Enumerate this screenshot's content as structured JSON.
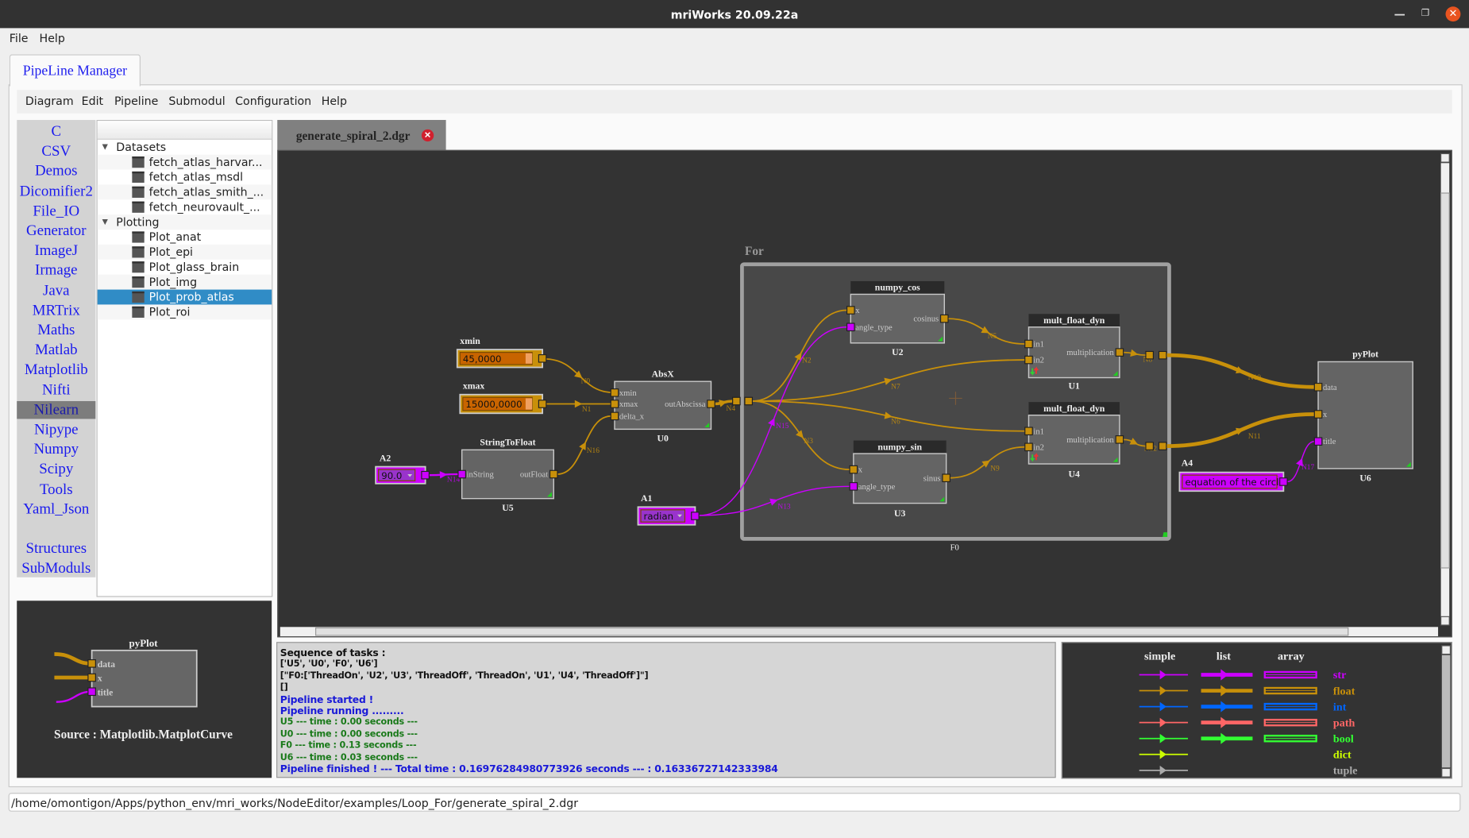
{
  "window": {
    "title": "mriWorks 20.09.22a",
    "minimize_icon": "minimize-icon",
    "restore_icon": "restore-icon",
    "close_icon": "close-icon"
  },
  "menubar": {
    "items": [
      "File",
      "Help"
    ]
  },
  "main_tab": "PipeLine Manager",
  "inner_menu": {
    "items": [
      "Diagram",
      "Edit",
      "Pipeline",
      "Submodul",
      "Configuration",
      "Help"
    ]
  },
  "library": {
    "items": [
      "C",
      "CSV",
      "Demos",
      "Dicomifier2",
      "File_IO",
      "Generator",
      "ImageJ",
      "Irmage",
      "Java",
      "MRTrix",
      "Maths",
      "Matlab",
      "Matplotlib",
      "Nifti",
      "Nilearn",
      "Nipype",
      "Numpy",
      "Scipy",
      "Tools",
      "Yaml_Json"
    ],
    "extra": [
      "Structures",
      "SubModuls"
    ],
    "selected": "Nilearn"
  },
  "tree": {
    "groups": [
      {
        "label": "Datasets",
        "items": [
          "fetch_atlas_harvar...",
          "fetch_atlas_msdl",
          "fetch_atlas_smith_...",
          "fetch_neurovault_..."
        ]
      },
      {
        "label": "Plotting",
        "items": [
          "Plot_anat",
          "Plot_epi",
          "Plot_glass_brain",
          "Plot_img",
          "Plot_prob_atlas",
          "Plot_roi"
        ]
      }
    ],
    "selected": "Plot_prob_atlas"
  },
  "preview": {
    "node_title": "pyPlot",
    "ports": [
      "data",
      "x",
      "title"
    ],
    "source": "Source : Matplotlib.MatplotCurve"
  },
  "diagram_tab": {
    "label": "generate_spiral_2.dgr"
  },
  "colors": {
    "float": "#c8900a",
    "str": "#cc00ff",
    "int": "#0066ff",
    "path": "#ff6666",
    "bool": "#33ff33",
    "dict": "#ccff00",
    "tuple": "#aaaaaa"
  },
  "diagram": {
    "for_label": "For",
    "frame_id": "F0",
    "constants": {
      "xmin": {
        "label": "xmin",
        "value": "45,0000"
      },
      "xmax": {
        "label": "xmax",
        "value": "15000,0000"
      },
      "A2": {
        "label": "A2",
        "value": "90.0"
      },
      "A1": {
        "label": "A1",
        "value": "radian"
      },
      "A4": {
        "label": "A4",
        "value": "equation of the circle"
      }
    },
    "nodes": {
      "U0": {
        "title": "AbsX",
        "id": "U0",
        "inputs": [
          "xmin",
          "xmax",
          "delta_x"
        ],
        "outputs": [
          "outAbscissa"
        ]
      },
      "U5": {
        "title": "StringToFloat",
        "id": "U5",
        "inputs": [
          "inString"
        ],
        "outputs": [
          "outFloat"
        ]
      },
      "U2": {
        "title": "numpy_cos",
        "id": "U2",
        "inputs": [
          "x",
          "angle_type"
        ],
        "outputs": [
          "cosinus"
        ]
      },
      "U3": {
        "title": "numpy_sin",
        "id": "U3",
        "inputs": [
          "x",
          "angle_type"
        ],
        "outputs": [
          "sinus"
        ]
      },
      "U1": {
        "title": "mult_float_dyn",
        "id": "U1",
        "inputs": [
          "in1",
          "in2"
        ],
        "outputs": [
          "multiplication"
        ]
      },
      "U4": {
        "title": "mult_float_dyn",
        "id": "U4",
        "inputs": [
          "in1",
          "in2"
        ],
        "outputs": [
          "multiplication"
        ]
      },
      "U6": {
        "title": "pyPlot",
        "id": "U6",
        "inputs": [
          "data",
          "x",
          "title"
        ],
        "outputs": []
      }
    },
    "edges": [
      {
        "label": "N0",
        "type": "float"
      },
      {
        "label": "N1",
        "type": "float"
      },
      {
        "label": "N16",
        "type": "float"
      },
      {
        "label": "N14",
        "type": "str"
      },
      {
        "label": "N4",
        "type": "float"
      },
      {
        "label": "N2",
        "type": "float"
      },
      {
        "label": "N3",
        "type": "float"
      },
      {
        "label": "N7",
        "type": "float"
      },
      {
        "label": "N6",
        "type": "float"
      },
      {
        "label": "N15",
        "type": "str"
      },
      {
        "label": "N13",
        "type": "str"
      },
      {
        "label": "N5",
        "type": "float"
      },
      {
        "label": "N9",
        "type": "float"
      },
      {
        "label": "N8",
        "type": "float"
      },
      {
        "label": "N12",
        "type": "float"
      },
      {
        "label": "N10",
        "type": "float"
      },
      {
        "label": "N11",
        "type": "float"
      },
      {
        "label": "N17",
        "type": "str"
      }
    ]
  },
  "console": {
    "lines": [
      {
        "text": "Sequence of tasks :",
        "color": "#111111"
      },
      {
        "text": "['U5', 'U0', 'F0', 'U6']",
        "color": "#111111"
      },
      {
        "text": "[\"F0:['ThreadOn', 'U2', 'U3', 'ThreadOff', 'ThreadOn', 'U1', 'U4', 'ThreadOff']\"]",
        "color": "#111111"
      },
      {
        "text": "[]",
        "color": "#111111"
      },
      {
        "text": "Pipeline started !",
        "color": "#1a1ad8"
      },
      {
        "text": "Pipeline running .........",
        "color": "#1a1ad8"
      },
      {
        "text": "U5 --- time : 0.00 seconds ---",
        "color": "#1a7a1a"
      },
      {
        "text": "U0 --- time : 0.00 seconds ---",
        "color": "#1a7a1a"
      },
      {
        "text": "F0 --- time : 0.13 seconds ---",
        "color": "#1a7a1a"
      },
      {
        "text": "U6 --- time : 0.03 seconds ---",
        "color": "#1a7a1a"
      },
      {
        "text": "Pipeline finished ! --- Total time : 0.16976284980773926 seconds --- : 0.16336727142333984",
        "color": "#1a1ad8"
      }
    ]
  },
  "legend": {
    "headers": [
      "simple",
      "list",
      "array"
    ],
    "types": [
      {
        "name": "str",
        "list": true
      },
      {
        "name": "float",
        "list": true
      },
      {
        "name": "int",
        "list": true
      },
      {
        "name": "path",
        "list": true
      },
      {
        "name": "bool",
        "list": true
      },
      {
        "name": "dict",
        "list": false
      },
      {
        "name": "tuple",
        "list": false
      }
    ]
  },
  "path": "/home/omontigon/Apps/python_env/mri_works/NodeEditor/examples/Loop_For/generate_spiral_2.dgr"
}
